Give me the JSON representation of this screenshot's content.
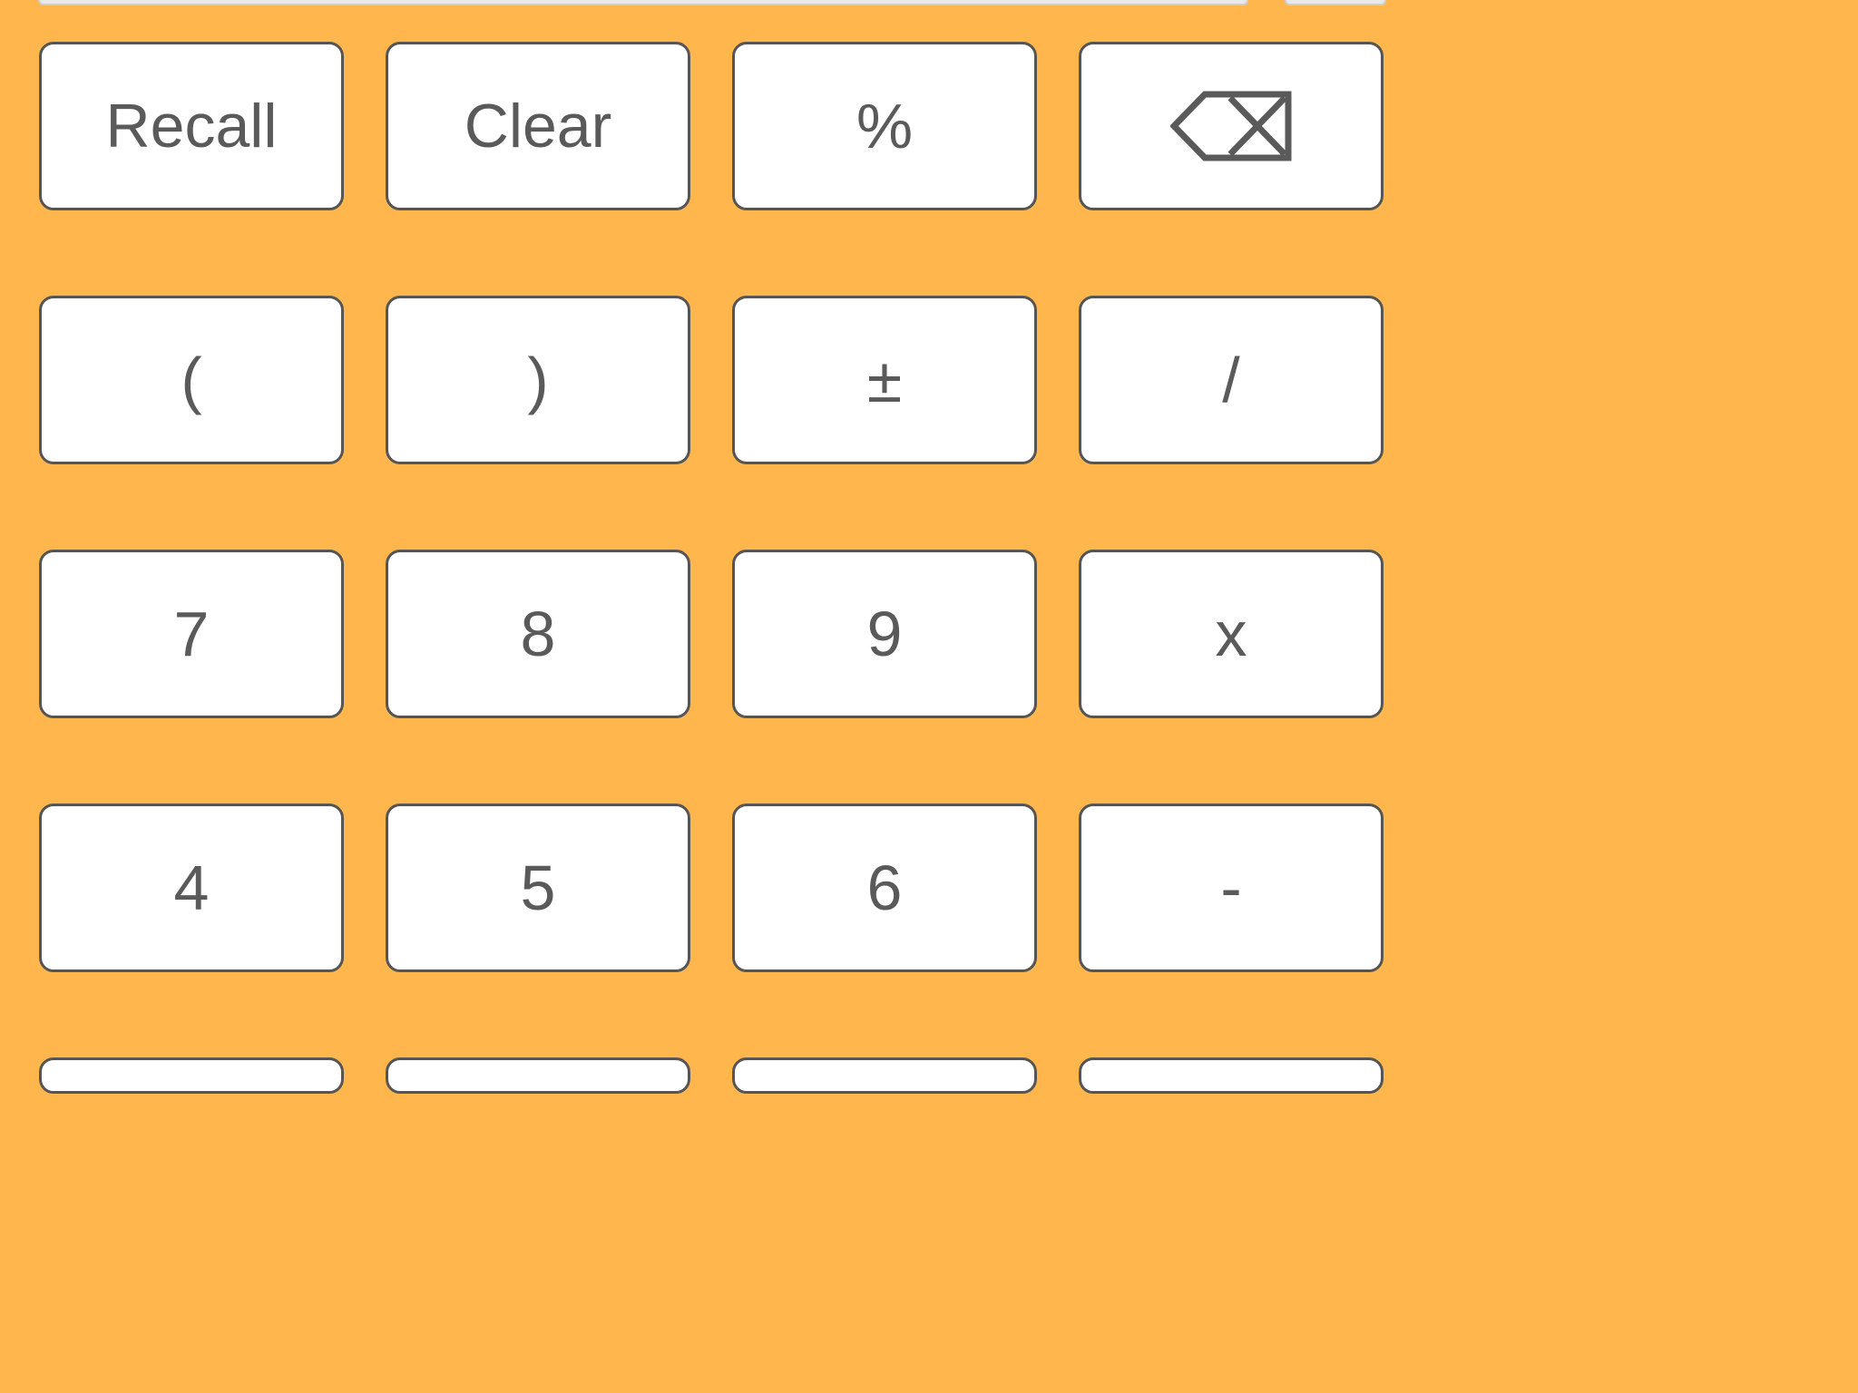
{
  "colors": {
    "background": "#FFB74D",
    "key_background": "#FFFFFF",
    "key_border": "#555555",
    "key_text": "#5A5A5A"
  },
  "keypad": {
    "rows": [
      [
        {
          "name": "recall-button",
          "label": "Recall"
        },
        {
          "name": "clear-button",
          "label": "Clear"
        },
        {
          "name": "percent-button",
          "label": "%"
        },
        {
          "name": "backspace-button",
          "label": "",
          "icon": "backspace-icon"
        }
      ],
      [
        {
          "name": "open-paren-button",
          "label": "("
        },
        {
          "name": "close-paren-button",
          "label": ")"
        },
        {
          "name": "plus-minus-button",
          "label": "±"
        },
        {
          "name": "divide-button",
          "label": "/"
        }
      ],
      [
        {
          "name": "digit-7-button",
          "label": "7"
        },
        {
          "name": "digit-8-button",
          "label": "8"
        },
        {
          "name": "digit-9-button",
          "label": "9"
        },
        {
          "name": "multiply-button",
          "label": "x"
        }
      ],
      [
        {
          "name": "digit-4-button",
          "label": "4"
        },
        {
          "name": "digit-5-button",
          "label": "5"
        },
        {
          "name": "digit-6-button",
          "label": "6"
        },
        {
          "name": "subtract-button",
          "label": "-"
        }
      ]
    ]
  }
}
